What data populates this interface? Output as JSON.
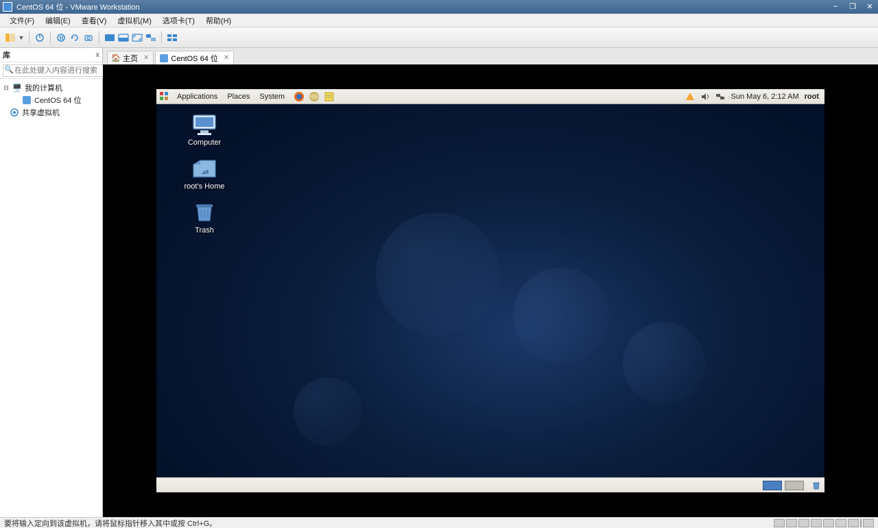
{
  "window": {
    "title": "CentOS 64 位 - VMware Workstation",
    "controls": {
      "min": "–",
      "max": "❐",
      "close": "✕"
    }
  },
  "menubar": {
    "items": [
      "文件(F)",
      "编辑(E)",
      "查看(V)",
      "虚拟机(M)",
      "选项卡(T)",
      "帮助(H)"
    ]
  },
  "sidebar": {
    "title": "库",
    "close": "x",
    "search_placeholder": "在此处键入内容进行搜索",
    "tree": {
      "root": "我的计算机",
      "vm": "CentOS 64 位",
      "shared": "共享虚拟机"
    }
  },
  "tabs": {
    "home": "主页",
    "vm": "CentOS 64 位"
  },
  "guest": {
    "top_menus": [
      "Applications",
      "Places",
      "System"
    ],
    "datetime": "Sun May  6,  2:12 AM",
    "user": "root",
    "desktop": {
      "computer": "Computer",
      "home": "root's Home",
      "trash": "Trash"
    }
  },
  "statusbar": {
    "hint": "要将输入定向到该虚拟机，请将鼠标指针移入其中或按 Ctrl+G。"
  }
}
